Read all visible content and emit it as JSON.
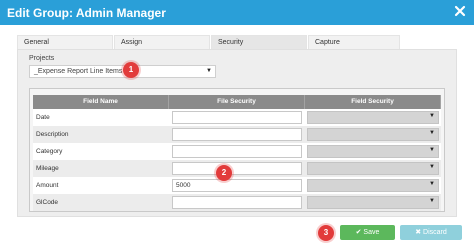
{
  "dialog": {
    "title": "Edit Group: Admin Manager",
    "close_glyph": "✕"
  },
  "tabs": [
    {
      "label": "General"
    },
    {
      "label": "Assign"
    },
    {
      "label": "Security"
    },
    {
      "label": "Capture"
    }
  ],
  "active_tab": "Security",
  "projects": {
    "label": "Projects",
    "selected": "_Expense Report Line Items"
  },
  "grid": {
    "headers": [
      "Field Name",
      "File Security",
      "Field Security"
    ],
    "rows": [
      {
        "field": "Date",
        "file_security": ""
      },
      {
        "field": "Description",
        "file_security": ""
      },
      {
        "field": "Category",
        "file_security": ""
      },
      {
        "field": "Mileage",
        "file_security": ""
      },
      {
        "field": "Amount",
        "file_security": "5000"
      },
      {
        "field": "GlCode",
        "file_security": ""
      }
    ]
  },
  "callouts": [
    "1",
    "2",
    "3"
  ],
  "buttons": {
    "save_label": "Save",
    "discard_label": "Discard"
  },
  "icons": {
    "close": "close-icon",
    "save": "check-icon",
    "discard": "x-icon",
    "dropdown": "caret-down-icon"
  },
  "colors": {
    "titlebar": "#2a9fd8",
    "save": "#5cb85c",
    "discard": "#8fd0dc",
    "callout": "#e23b3b",
    "grid_header": "#8a8a8a"
  }
}
